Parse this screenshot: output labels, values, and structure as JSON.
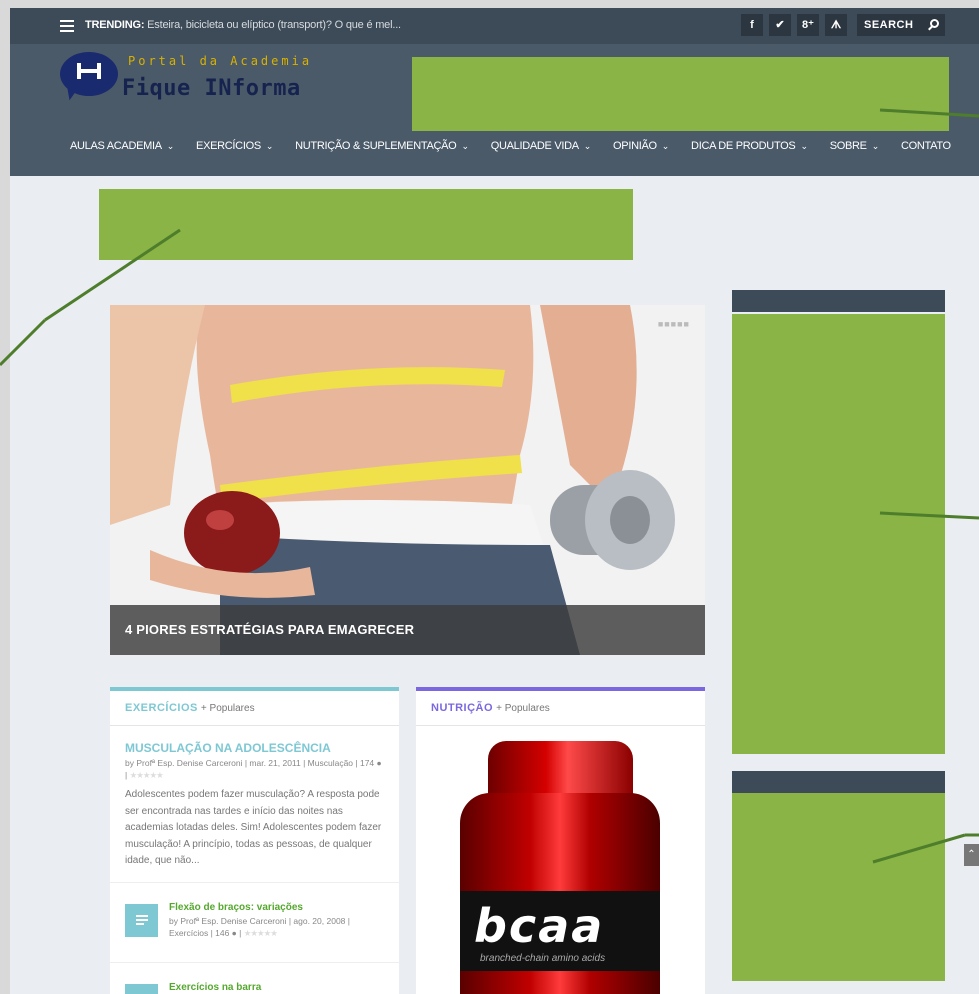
{
  "topbar": {
    "trending_label": "TRENDING:",
    "trending_text": "Esteira, bicicleta ou elíptico (transport)? O que é mel...",
    "social": [
      {
        "icon": "facebook-icon",
        "glyph": "f"
      },
      {
        "icon": "twitter-icon",
        "glyph": "✔"
      },
      {
        "icon": "google-plus-icon",
        "glyph": "8⁺"
      },
      {
        "icon": "rss-icon",
        "glyph": "ᗑ"
      }
    ],
    "search_label": "SEARCH"
  },
  "logo": {
    "line1": "Portal da Academia",
    "line2": "Fique INforma"
  },
  "nav": {
    "items": [
      {
        "label": "AULAS ACADEMIA",
        "chevron": "⌄"
      },
      {
        "label": "EXERCÍCIOS",
        "chevron": "⌄"
      },
      {
        "label": "NUTRIÇÃO & SUPLEMENTAÇÃO",
        "chevron": "⌄"
      },
      {
        "label": "QUALIDADE VIDA",
        "chevron": "⌄"
      },
      {
        "label": "OPINIÃO",
        "chevron": "⌄"
      },
      {
        "label": "DICA DE PRODUTOS",
        "chevron": "⌄"
      },
      {
        "label": "SOBRE",
        "chevron": "⌄"
      },
      {
        "label": "CONTATO",
        "chevron": ""
      }
    ]
  },
  "featured": {
    "title": "4 PIORES ESTRATÉGIAS PARA EMAGRECER",
    "dots": "■■■■■"
  },
  "module_exercicios": {
    "category": "EXERCÍCIOS",
    "suffix": "+ Populares",
    "main_title": "MUSCULAÇÃO NA ADOLESCÊNCIA",
    "main_meta": "by Profª Esp. Denise Carceroni | mar. 21, 2011 | Musculação | 174 ● |",
    "main_stars": "★★★★★",
    "excerpt": "Adolescentes podem fazer musculação? A resposta pode ser encontrada nas tardes e início das noites nas academias lotadas deles. Sim! Adolescentes podem fazer musculação! A princípio, todas as pessoas, de qualquer idade, que não...",
    "posts": [
      {
        "title": "Flexão de braços: variações",
        "meta": "by Profª Esp. Denise Carceroni | ago. 20, 2008 | Exercícios | 146 ● |",
        "stars": "★★★★★"
      },
      {
        "title": "Exercícios na barra",
        "meta": "",
        "stars": ""
      }
    ]
  },
  "module_nutricao": {
    "category": "NUTRIÇÃO",
    "suffix": "+ Populares",
    "product_brand": "bcaa",
    "product_sub": "branched-chain amino acids"
  },
  "colors": {
    "accent_green": "#8ab445",
    "topbar": "#3d4a57",
    "header": "#4b5a69",
    "exercicios_accent": "#7ec8d4",
    "nutricao_accent": "#7b68e0"
  },
  "back_to_top": "⌃"
}
